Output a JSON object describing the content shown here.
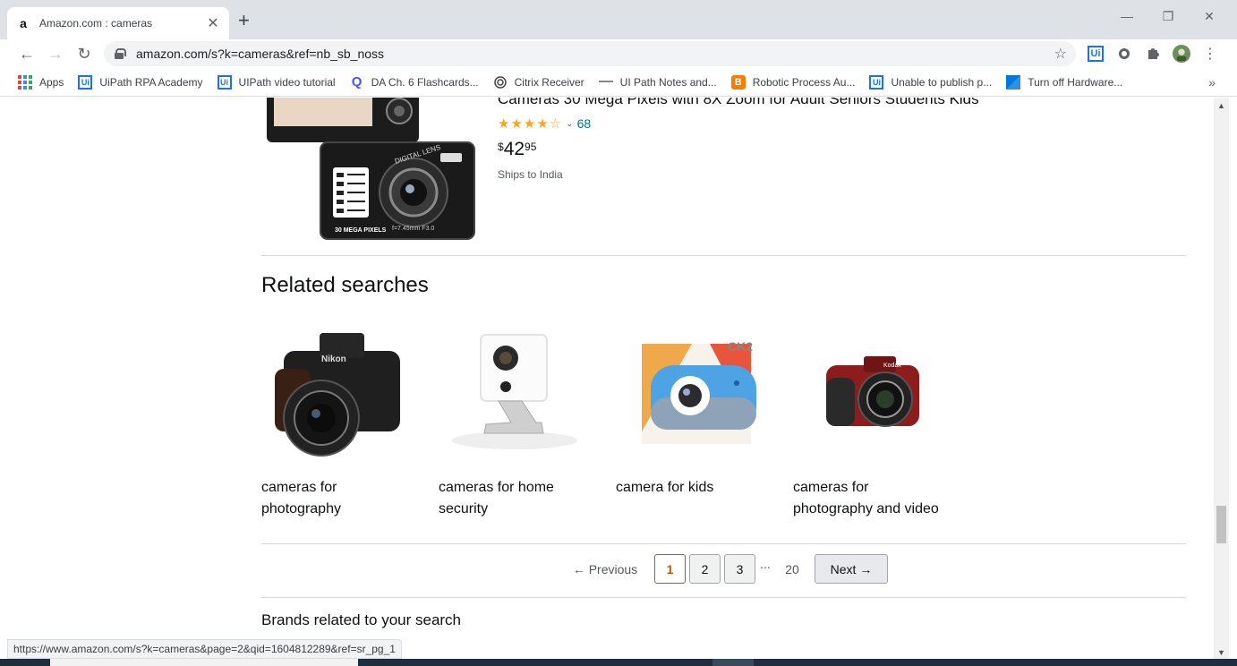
{
  "browser": {
    "tab_title": "Amazon.com : cameras",
    "tab_favicon": "a",
    "url": "amazon.com/s?k=cameras&ref=nb_sb_noss",
    "status_url": "https://www.amazon.com/s?k=cameras&page=2&qid=1604812289&ref=sr_pg_1",
    "bookmarks": [
      {
        "label": "Apps",
        "icon": "apps-grid-icon"
      },
      {
        "label": "UiPath RPA Academy",
        "icon": "uipath-icon"
      },
      {
        "label": "UIPath video tutorial",
        "icon": "uipath-icon"
      },
      {
        "label": "DA Ch. 6 Flashcards...",
        "icon": "quizlet-icon"
      },
      {
        "label": "Citrix Receiver",
        "icon": "citrix-icon"
      },
      {
        "label": "UI Path Notes and...",
        "icon": "page-icon"
      },
      {
        "label": "Robotic Process Au...",
        "icon": "blogger-icon"
      },
      {
        "label": "Unable to publish p...",
        "icon": "uipath-icon"
      },
      {
        "label": "Turn off Hardware...",
        "icon": "windows-icon"
      }
    ]
  },
  "product": {
    "title": "Cameras 30 Mega Pixels with 8X Zoom for Adult Seniors Students Kids",
    "stars": "★★★★☆",
    "rating": 4.0,
    "rating_count": "68",
    "price_symbol": "$",
    "price_whole": "42",
    "price_fraction": "95",
    "shipping": "Ships to India",
    "image_text": {
      "lens": "DIGITAL LENS",
      "focal": "f=7.45mm F3.0",
      "badge": "30 MEGA PIXELS"
    }
  },
  "related": {
    "heading": "Related searches",
    "items": [
      {
        "label": "cameras for photography",
        "image": "dslr-camera"
      },
      {
        "label": "cameras for home security",
        "image": "security-camera"
      },
      {
        "label": "camera for kids",
        "image": "kids-camera"
      },
      {
        "label": "cameras for photography and video",
        "image": "bridge-camera"
      }
    ],
    "image_text": {
      "nikon": "Nikon",
      "ck2": "CK2",
      "kodak": "Kodak"
    }
  },
  "pagination": {
    "previous": "← Previous",
    "pages": [
      "1",
      "2",
      "3"
    ],
    "ellipsis": "...",
    "last": "20",
    "next": "Next →",
    "current": "1"
  },
  "brands": {
    "heading": "Brands related to your search"
  },
  "colors": {
    "price_text": "#0f1111",
    "link": "#007185",
    "star": "#f5a623",
    "current_page": "#c45500"
  }
}
